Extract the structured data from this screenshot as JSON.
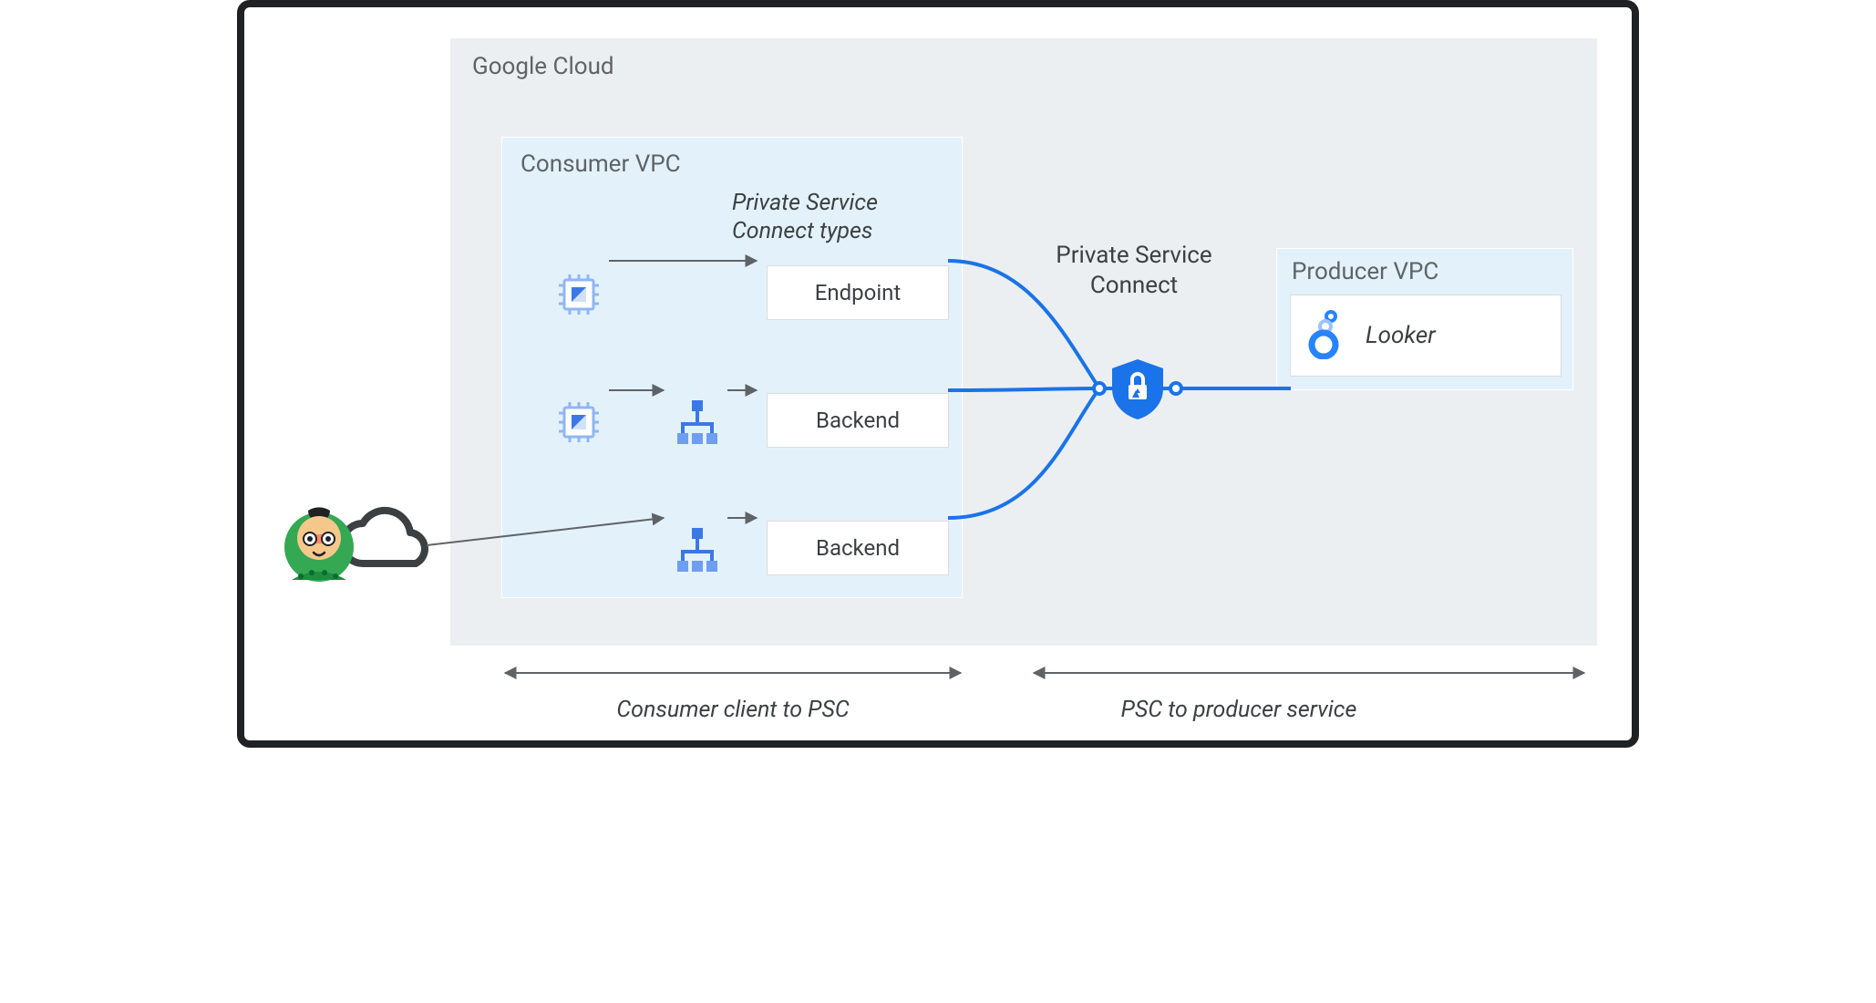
{
  "cloud": {
    "label": "Google Cloud"
  },
  "consumer_vpc": {
    "label": "Consumer VPC",
    "psc_types_heading": "Private Service Connect types",
    "rows": [
      {
        "label": "Endpoint"
      },
      {
        "label": "Backend"
      },
      {
        "label": "Backend"
      }
    ]
  },
  "psc": {
    "title": "Private Service Connect"
  },
  "producer_vpc": {
    "label": "Producer VPC",
    "service": "Looker"
  },
  "bottom": {
    "left": "Consumer client to PSC",
    "right": "PSC to producer service"
  },
  "colors": {
    "blue": "#1a73e8",
    "grey": "#5f6368",
    "panel": "#eceff1",
    "vpc": "#e3f2fa"
  }
}
